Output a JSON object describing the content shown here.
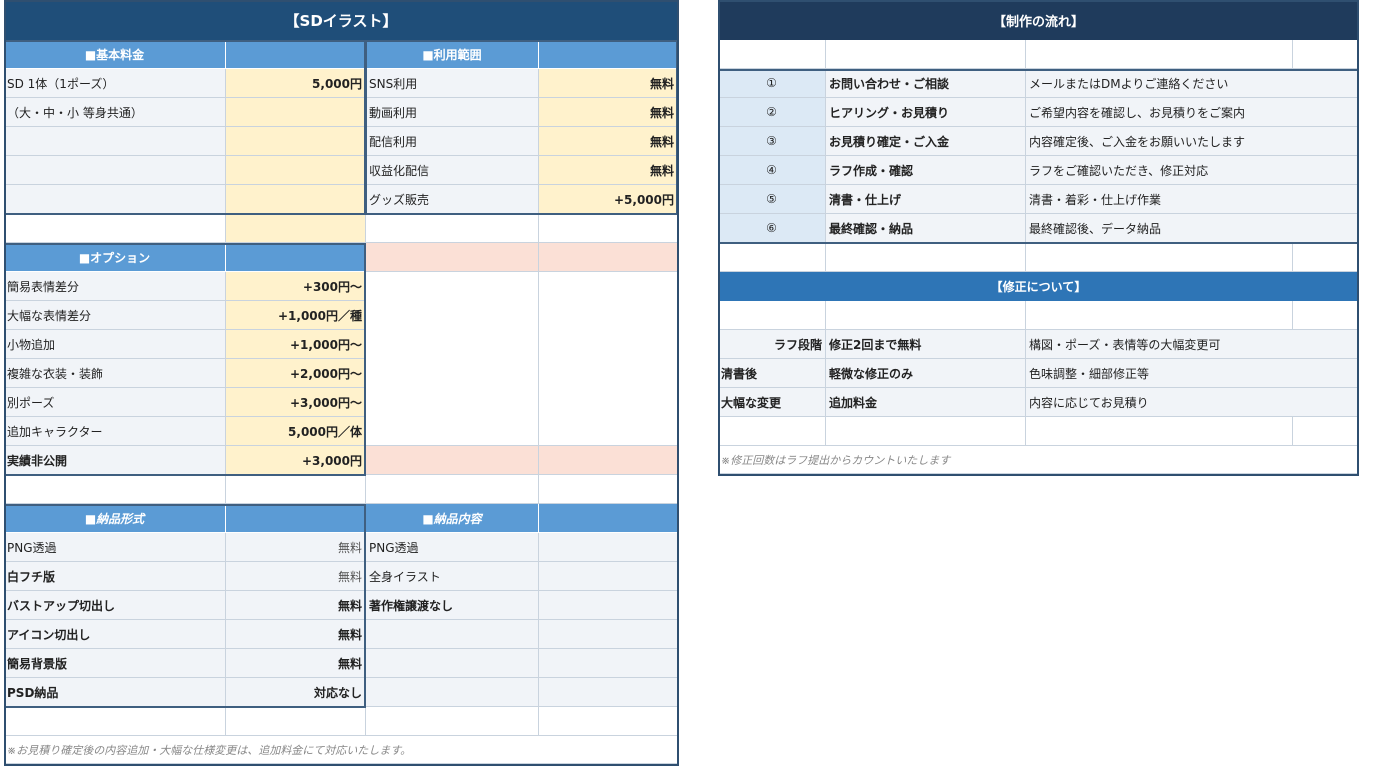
{
  "left": {
    "title": "【SDイラスト】",
    "basic": {
      "header": "■基本料金",
      "rows": [
        {
          "label": "SD 1体（1ポーズ）",
          "value": "5,000円"
        },
        {
          "label": "（大・中・小 等身共通）",
          "value": ""
        }
      ]
    },
    "usage": {
      "header": "■利用範囲",
      "rows": [
        {
          "label": "SNS利用",
          "value": "無料"
        },
        {
          "label": "動画利用",
          "value": "無料"
        },
        {
          "label": "配信利用",
          "value": "無料"
        },
        {
          "label": "収益化配信",
          "value": "無料"
        },
        {
          "label": "グッズ販売",
          "value": "+5,000円"
        }
      ]
    },
    "options": {
      "header": "■オプション",
      "rows": [
        {
          "label": "簡易表情差分",
          "value": "+300円～"
        },
        {
          "label": "大幅な表情差分",
          "value": "+1,000円／種"
        },
        {
          "label": "小物追加",
          "value": "+1,000円～"
        },
        {
          "label": "複雑な衣装・装飾",
          "value": "+2,000円～"
        },
        {
          "label": "別ポーズ",
          "value": "+3,000円～"
        },
        {
          "label": "追加キャラクター",
          "value": "5,000円／体"
        },
        {
          "label": "実績非公開",
          "value": "+3,000円"
        }
      ]
    },
    "format": {
      "header": "■納品形式",
      "rows": [
        {
          "label": "PNG透過",
          "value": "無料"
        },
        {
          "label": "白フチ版",
          "value": "無料"
        },
        {
          "label": "バストアップ切出し",
          "value": "無料"
        },
        {
          "label": "アイコン切出し",
          "value": "無料"
        },
        {
          "label": "簡易背景版",
          "value": "無料"
        },
        {
          "label": "PSD納品",
          "value": "対応なし"
        }
      ]
    },
    "contents": {
      "header": "■納品内容",
      "rows": [
        "PNG透過",
        "全身イラスト",
        "著作権譲渡なし"
      ]
    },
    "note": "※お見積り確定後の内容追加・大幅な仕様変更は、追加料金にて対応いたします。"
  },
  "right": {
    "title": "【制作の流れ】",
    "flow": [
      {
        "no": "①",
        "step": "お問い合わせ・ご相談",
        "desc": "メールまたはDMよりご連絡ください"
      },
      {
        "no": "②",
        "step": "ヒアリング・お見積り",
        "desc": "ご希望内容を確認し、お見積りをご案内"
      },
      {
        "no": "③",
        "step": "お見積り確定・ご入金",
        "desc": "内容確定後、ご入金をお願いいたします"
      },
      {
        "no": "④",
        "step": "ラフ作成・確認",
        "desc": "ラフをご確認いただき、修正対応"
      },
      {
        "no": "⑤",
        "step": "清書・仕上げ",
        "desc": "清書・着彩・仕上げ作業"
      },
      {
        "no": "⑥",
        "step": "最終確認・納品",
        "desc": "最終確認後、データ納品"
      }
    ],
    "revision": {
      "header": "【修正について】",
      "rows": [
        {
          "stage": "ラフ段階",
          "rule": "修正2回まで無料",
          "desc": "構図・ポーズ・表情等の大幅変更可"
        },
        {
          "stage": "清書後",
          "rule": "軽微な修正のみ",
          "desc": "色味調整・細部修正等"
        },
        {
          "stage": "大幅な変更",
          "rule": "追加料金",
          "desc": "内容に応じてお見積り"
        }
      ],
      "note": "※修正回数はラフ提出からカウントいたします"
    }
  }
}
